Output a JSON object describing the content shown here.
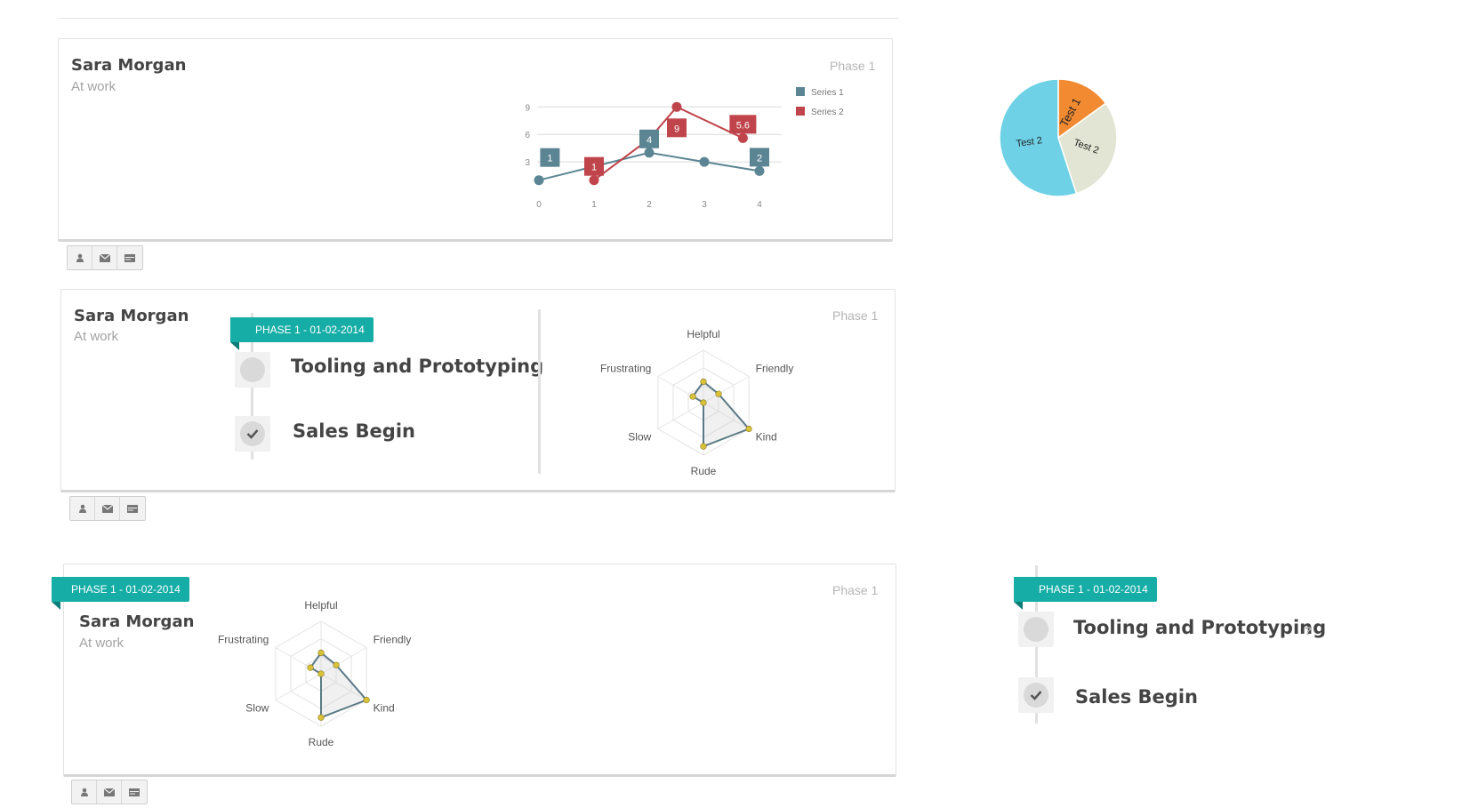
{
  "cards": [
    {
      "name": "Sara Morgan",
      "subtitle": "At work",
      "phase": "Phase 1"
    },
    {
      "name": "Sara Morgan",
      "subtitle": "At work",
      "phase": "Phase 1"
    },
    {
      "name": "Sara Morgan",
      "subtitle": "At work",
      "phase": "Phase 1"
    }
  ],
  "actions": {
    "icons": [
      "user-icon",
      "envelope-icon",
      "card-icon"
    ]
  },
  "timeline": {
    "ribbon": "PHASE 1 - 01-02-2014",
    "milestones": [
      {
        "title": "Tooling and Prototyping",
        "state": "pending"
      },
      {
        "title": "Sales Begin",
        "state": "done"
      }
    ],
    "help": "?"
  },
  "chart_data": [
    {
      "type": "line",
      "x": [
        0,
        1,
        2,
        3,
        4
      ],
      "series": [
        {
          "name": "Series 1",
          "color": "#5b8593",
          "points": [
            [
              0,
              1
            ],
            [
              1,
              2.5
            ],
            [
              2,
              4
            ],
            [
              3,
              3
            ],
            [
              4,
              2
            ]
          ],
          "labels": [
            {
              "x": 0.2,
              "text": "1"
            },
            {
              "x": 2,
              "text": "4"
            },
            {
              "x": 4,
              "text": "2"
            }
          ]
        },
        {
          "name": "Series 2",
          "color": "#c0444b",
          "points": [
            [
              1,
              1
            ],
            [
              2,
              5.5
            ],
            [
              2.5,
              9
            ],
            [
              3.7,
              5.6
            ]
          ],
          "labels": [
            {
              "x": 1,
              "text": "1"
            },
            {
              "x": 2.5,
              "text": "9"
            },
            {
              "x": 3.7,
              "text": "5.6"
            }
          ]
        }
      ],
      "yticks": [
        3,
        6,
        9
      ],
      "xlabel": "",
      "ylabel": "",
      "ylim": [
        0,
        10
      ],
      "grid": true,
      "legend": "top-right"
    },
    {
      "type": "pie",
      "slices": [
        {
          "label": "Test 1",
          "value": 15,
          "color": "#f28a31"
        },
        {
          "label": "Test 2",
          "value": 30,
          "color": "#e2e5d3"
        },
        {
          "label": "Test 2",
          "value": 55,
          "color": "#6ed1e6"
        }
      ]
    },
    {
      "type": "radar",
      "axes": [
        "Helpful",
        "Friendly",
        "Kind",
        "Rude",
        "Slow",
        "Frustrating"
      ],
      "max": 3,
      "values": [
        1.2,
        1,
        3,
        2.5,
        0,
        0.7
      ],
      "color": "#5b7a85",
      "point_color": "#d9c23a"
    }
  ],
  "colors": {
    "accent": "#16ada6",
    "series1": "#5b8593",
    "series2": "#c0444b"
  }
}
